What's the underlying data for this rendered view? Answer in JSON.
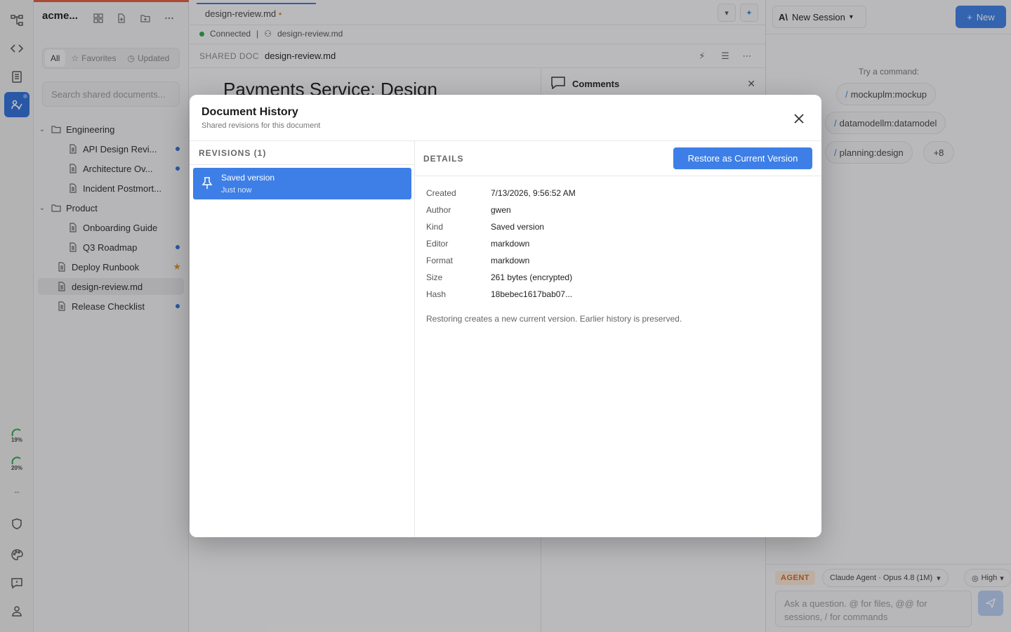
{
  "sidebar": {
    "workspace": "acme...",
    "filters": [
      "All",
      "Favorites",
      "Updated"
    ],
    "search_placeholder": "Search shared documents...",
    "tree": [
      {
        "label": "Engineering"
      },
      {
        "label": "API Design Revi..."
      },
      {
        "label": "Architecture Ov..."
      },
      {
        "label": "Incident Postmort..."
      },
      {
        "label": "Product"
      },
      {
        "label": "Onboarding Guide"
      },
      {
        "label": "Q3 Roadmap"
      },
      {
        "label": "Deploy Runbook"
      },
      {
        "label": "design-review.md"
      },
      {
        "label": "Release Checklist"
      }
    ]
  },
  "activity": {
    "gauge1": "19%",
    "gauge2": "20%",
    "dashes": "--"
  },
  "editor": {
    "tab_label": "design-review.md",
    "tab_modified": "•",
    "status": "Connected",
    "status_sep": "|",
    "status_file": "design-review.md",
    "kicker": "SHARED DOC",
    "doc_name": "design-review.md",
    "doc_title": "Payments Service: Design",
    "comments_title": "Comments"
  },
  "agent": {
    "session_label": "New Session",
    "new_label": "New",
    "try_label": "Try a command:",
    "chips": [
      {
        "slash": "/",
        "label": "mockuplm:mockup"
      },
      {
        "slash": "/",
        "label": "datamodellm:datamodel"
      },
      {
        "slash": "/",
        "label": "planning:design"
      },
      {
        "slash": "",
        "label": "+8"
      }
    ],
    "badge": "AGENT",
    "model": "Claude Agent · Opus 4.8 (1M)",
    "effort": "High",
    "input_placeholder": "Ask a question. @ for files, @@ for sessions, / for commands"
  },
  "modal": {
    "title": "Document History",
    "subtitle": "Shared revisions for this document",
    "revisions_header": "REVISIONS (1)",
    "revision": {
      "title": "Saved version",
      "time": "Just now"
    },
    "details_header": "DETAILS",
    "restore_label": "Restore as Current Version",
    "details": [
      {
        "key": "Created",
        "value": "7/13/2026, 9:56:52 AM"
      },
      {
        "key": "Author",
        "value": "gwen"
      },
      {
        "key": "Kind",
        "value": "Saved version"
      },
      {
        "key": "Editor",
        "value": "markdown"
      },
      {
        "key": "Format",
        "value": "markdown"
      },
      {
        "key": "Size",
        "value": "261 bytes (encrypted)"
      },
      {
        "key": "Hash",
        "value": "18bebec1617bab07..."
      }
    ],
    "note": "Restoring creates a new current version. Earlier history is preserved."
  }
}
